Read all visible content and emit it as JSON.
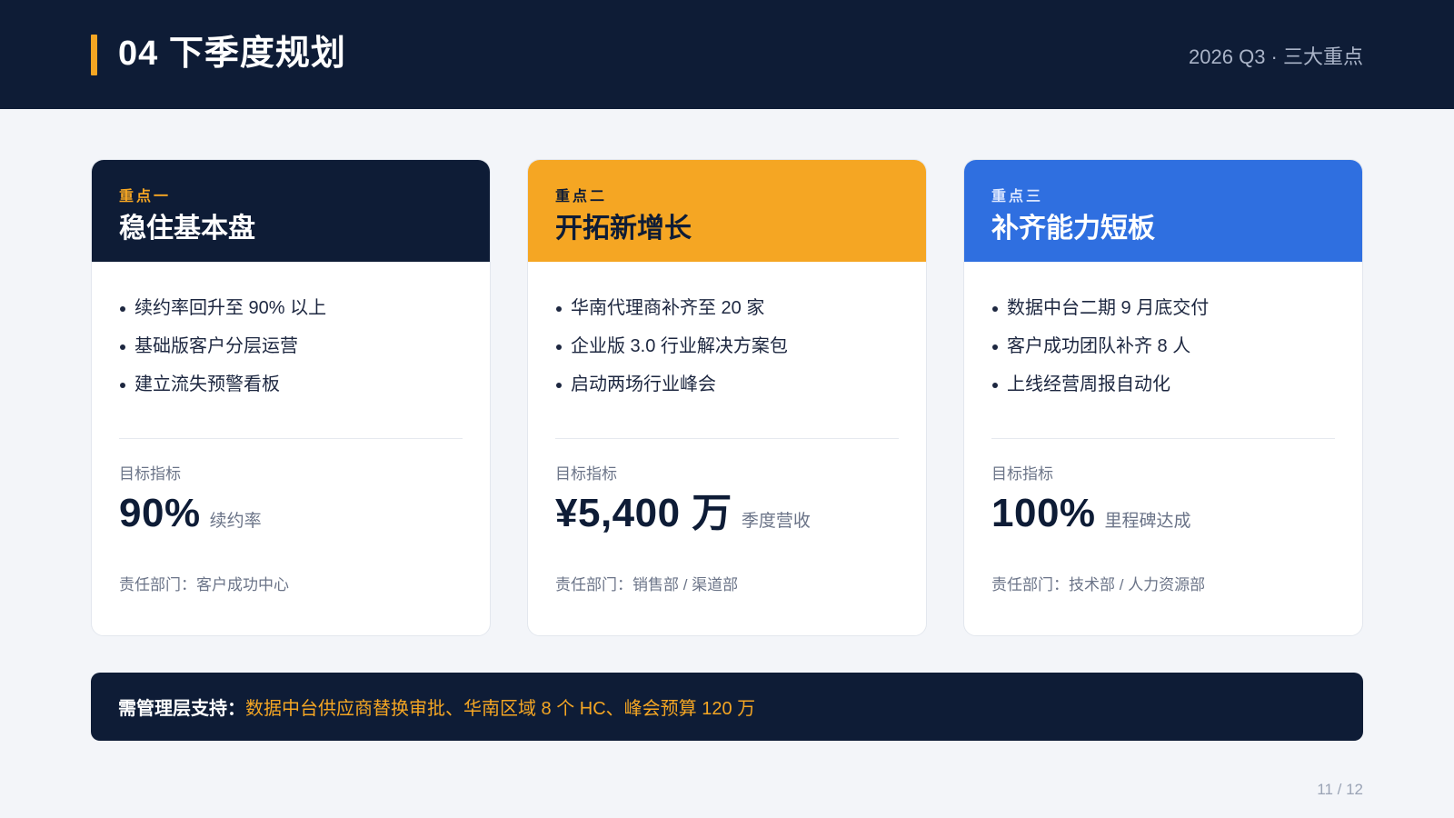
{
  "header": {
    "title": "04 下季度规划",
    "subtitle": "2026 Q3 · 三大重点"
  },
  "cards": [
    {
      "tag": "重点一",
      "title": "稳住基本盘",
      "bullets": [
        "续约率回升至 90% 以上",
        "基础版客户分层运营",
        "建立流失预警看板"
      ],
      "metric_label": "目标指标",
      "metric_value": "90%",
      "metric_unit": "续约率",
      "owner": "责任部门：客户成功中心"
    },
    {
      "tag": "重点二",
      "title": "开拓新增长",
      "bullets": [
        "华南代理商补齐至 20 家",
        "企业版 3.0 行业解决方案包",
        "启动两场行业峰会"
      ],
      "metric_label": "目标指标",
      "metric_value": "¥5,400 万",
      "metric_unit": "季度营收",
      "owner": "责任部门：销售部 / 渠道部"
    },
    {
      "tag": "重点三",
      "title": "补齐能力短板",
      "bullets": [
        "数据中台二期 9 月底交付",
        "客户成功团队补齐 8 人",
        "上线经营周报自动化"
      ],
      "metric_label": "目标指标",
      "metric_value": "100%",
      "metric_unit": "里程碑达成",
      "owner": "责任部门：技术部 / 人力资源部"
    }
  ],
  "footer": {
    "lead": "需管理层支持：",
    "items": "数据中台供应商替换审批、华南区域 8 个 HC、峰会预算 120 万"
  },
  "page_number": "11 / 12",
  "colors": {
    "navy": "#0e1c36",
    "amber": "#f5a623",
    "blue": "#2f6fe0",
    "background": "#f3f5f9"
  }
}
